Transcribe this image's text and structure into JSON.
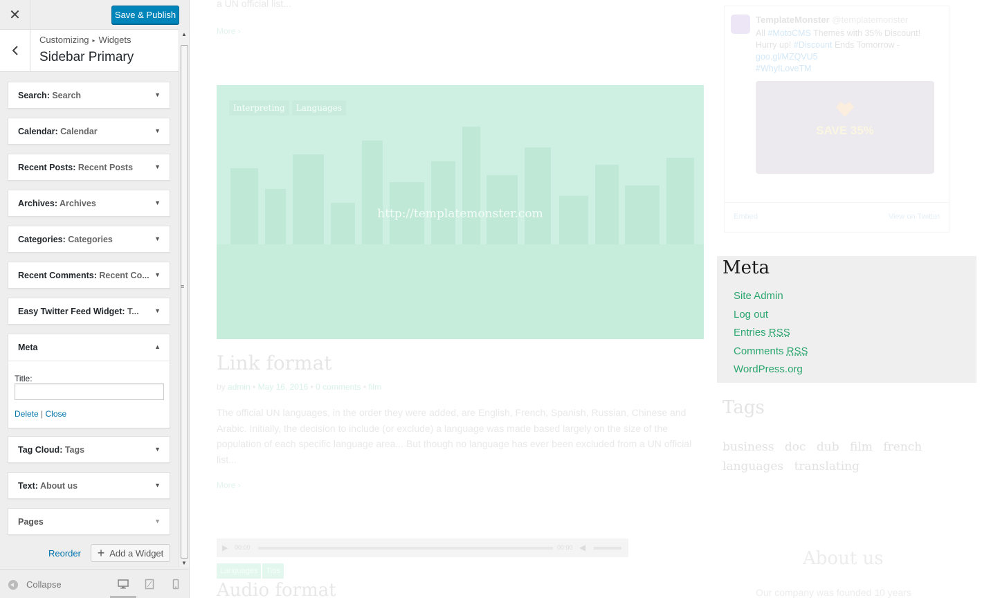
{
  "header": {
    "close_glyph": "✕",
    "publish_label": "Save & Publish",
    "breadcrumb_root": "Customizing",
    "breadcrumb_sep": "▸",
    "breadcrumb_section": "Widgets",
    "panel_title": "Sidebar Primary"
  },
  "widgets": [
    {
      "type": "Search",
      "title": "Search"
    },
    {
      "type": "Calendar",
      "title": "Calendar"
    },
    {
      "type": "Recent Posts",
      "title": "Recent Posts"
    },
    {
      "type": "Archives",
      "title": "Archives"
    },
    {
      "type": "Categories",
      "title": "Categories"
    },
    {
      "type": "Recent Comments",
      "title": "Recent Co..."
    },
    {
      "type": "Easy Twitter Feed Widget",
      "title": "T..."
    },
    {
      "type": "Meta",
      "title": ""
    },
    {
      "type": "Tag Cloud",
      "title": "Tags"
    },
    {
      "type": "Text",
      "title": "About us"
    },
    {
      "type": "Pages",
      "title": ""
    }
  ],
  "meta_form": {
    "title_label": "Title:",
    "title_value": "",
    "delete_label": "Delete",
    "separator": "|",
    "close_label": "Close"
  },
  "footer_actions": {
    "reorder_label": "Reorder",
    "add_widget_label": "Add a Widget"
  },
  "cz_footer": {
    "collapse_label": "Collapse",
    "devices": [
      "desktop",
      "tablet",
      "mobile"
    ],
    "active_device": "desktop"
  },
  "preview": {
    "top_text": "a UN official list...",
    "more_label": "More",
    "hero_tags": [
      "Interpreting",
      "Languages"
    ],
    "hero_link": "http://templatemonster.com",
    "post": {
      "title": "Link format",
      "author": "admin",
      "date": "May 16, 2016",
      "comments": "0 comments",
      "category": "film",
      "body": "The official UN languages, in the order they were added, are English, French, Spanish, Russian, Chinese and Arabic. Initially, the decision to include (or exclude) a language was made based largely on the size of the population of each specific language area... But though no language has ever been excluded from a UN official list..."
    },
    "audio": {
      "time_start": "00:00",
      "time_end": "00:00"
    },
    "audio_tags": [
      "Languages",
      "Tips"
    ],
    "audio_title": "Audio format",
    "tweet": {
      "name": "TemplateMonster",
      "handle": "@templatemonster",
      "line1_pre": "All ",
      "line1_tag": "#MotoCMS",
      "line1_post": " Themes with 35% Discount!",
      "line2_pre": "Hurry up! ",
      "line2_tag": "#Discount",
      "line2_post": " Ends Tomorrow  -",
      "link": "goo.gl/MZQVU5",
      "hashtag": "#WhyILoveTM",
      "image_text": "SAVE 35%",
      "embed_label": "Embed",
      "view_label": "View on Twitter"
    },
    "meta": {
      "title": "Meta",
      "site_admin": "Site Admin",
      "log_out": "Log out",
      "entries_pre": "Entries ",
      "comments_pre": "Comments ",
      "rss": "RSS",
      "wordpress": "WordPress.org"
    },
    "tags_title": "Tags",
    "tag_cloud": [
      "business",
      "doc",
      "dub",
      "film",
      "french",
      "languages",
      "translating"
    ],
    "about_title": "About us",
    "about_text": "Our company was founded 10 years"
  }
}
